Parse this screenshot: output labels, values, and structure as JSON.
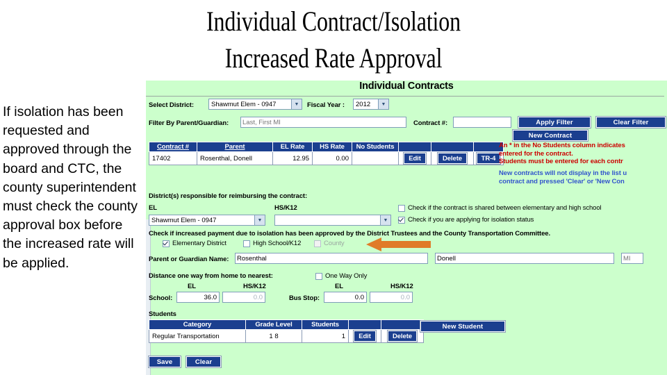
{
  "slide": {
    "title": "Individual Contract/Isolation\nIncreased Rate Approval",
    "note": "If isolation has been requested and approved through the board and CTC, the county superintendent must check the county approval box before the increased rate will be applied."
  },
  "app": {
    "page_heading": "Individual Contracts",
    "filters": {
      "select_district_label": "Select District:",
      "select_district_value": "Shawmut Elem - 0947",
      "fiscal_year_label": "Fiscal Year :",
      "fiscal_year_value": "2012",
      "filter_parent_label": "Filter By Parent/Guardian:",
      "filter_parent_placeholder": "Last, First MI",
      "filter_parent_value": "",
      "contract_num_label": "Contract #:",
      "contract_num_value": "",
      "apply_filter_label": "Apply Filter",
      "clear_filter_label": "Clear Filter",
      "new_contract_label": "New Contract"
    },
    "contracts_table": {
      "headers": [
        "Contract #",
        "Parent",
        "EL Rate",
        "HS Rate",
        "No Students",
        "",
        "",
        ""
      ],
      "rows": [
        {
          "contract_number": "17402",
          "parent": "Rosenthal, Donell",
          "el_rate": "12.95",
          "hs_rate": "0.00",
          "no_students": "",
          "edit_label": "Edit",
          "delete_label": "Delete",
          "tr4_label": "TR-4"
        }
      ]
    },
    "notices": {
      "red": "An * in the No Students column indicates\nentered for the contract.\nStudents must be entered for each contr",
      "blue": "New contracts will not display in the list u\ncontract and pressed 'Clear' or 'New Con"
    },
    "reimbursing": {
      "section_label": "District(s) responsible for reimbursing the contract:",
      "el_label": "EL",
      "hs_label": "HS/K12",
      "el_value": "Shawmut Elem - 0947",
      "hs_value": "",
      "shared_checkbox_label": "Check if the contract is shared between elementary and high school",
      "shared_checked": false,
      "isolation_checkbox_label": "Check if you are applying for isolation status",
      "isolation_checked": true
    },
    "approval": {
      "instruction": "Check if increased payment due to isolation has been approved by the District Trustees and the County Transportation Committee.",
      "options": [
        {
          "label": "Elementary District",
          "checked": true,
          "disabled": false
        },
        {
          "label": "High School/K12",
          "checked": false,
          "disabled": false
        },
        {
          "label": "County",
          "checked": false,
          "disabled": true
        }
      ]
    },
    "parent_name": {
      "label": "Parent or Guardian Name:",
      "last": "Rosenthal",
      "first": "Donell",
      "mi_placeholder": "MI",
      "mi": ""
    },
    "distance": {
      "label": "Distance one way from home to nearest:",
      "one_way_only_label": "One Way Only",
      "one_way_only_checked": false,
      "col_el": "EL",
      "col_hs": "HS/K12",
      "school_label": "School:",
      "school_el": "36.0",
      "school_hs": "0.0",
      "bus_stop_label": "Bus Stop:",
      "bus_el": "0.0",
      "bus_hs": "0.0"
    },
    "students": {
      "section_label": "Students",
      "headers": [
        "Category",
        "Grade Level",
        "Students",
        "",
        ""
      ],
      "rows": [
        {
          "category": "Regular Transportation",
          "grade_level": "1 8",
          "students": "1",
          "edit_label": "Edit",
          "delete_label": "Delete"
        }
      ],
      "new_student_label": "New Student"
    },
    "footer": {
      "save_label": "Save",
      "clear_label": "Clear"
    }
  },
  "colors": {
    "panel_bg": "#ccffcc",
    "button_blue": "#1b3f8f",
    "notice_red": "#cc0000",
    "notice_blue": "#3355cc",
    "arrow_orange": "#e07b28"
  }
}
